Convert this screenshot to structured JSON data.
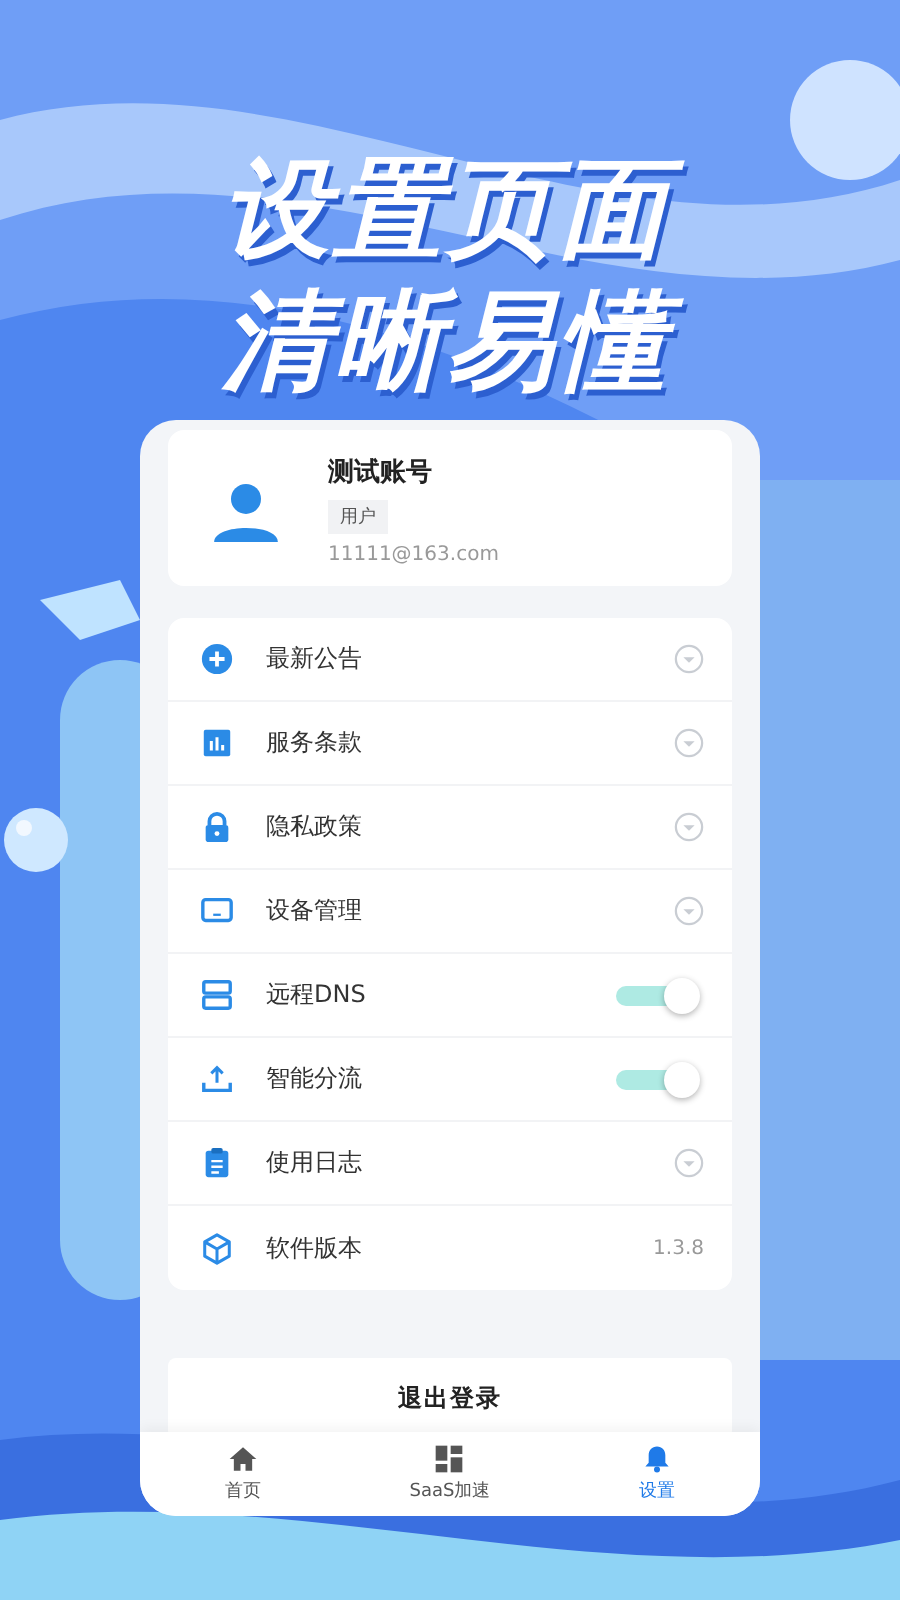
{
  "headline": [
    "设置页面",
    "清晰易懂"
  ],
  "profile": {
    "name": "测试账号",
    "role": "用户",
    "email": "11111@163.com"
  },
  "settings": [
    {
      "kind": "arrow",
      "label": "最新公告"
    },
    {
      "kind": "arrow",
      "label": "服务条款"
    },
    {
      "kind": "arrow",
      "label": "隐私政策"
    },
    {
      "kind": "arrow",
      "label": "设备管理"
    },
    {
      "kind": "toggle",
      "label": "远程DNS",
      "on": true
    },
    {
      "kind": "toggle",
      "label": "智能分流",
      "on": true
    },
    {
      "kind": "arrow",
      "label": "使用日志"
    },
    {
      "kind": "version",
      "label": "软件版本",
      "value": "1.3.8"
    }
  ],
  "logout": "退出登录",
  "tabs": [
    {
      "label": "首页",
      "selected": false
    },
    {
      "label": "SaaS加速",
      "selected": false
    },
    {
      "label": "设置",
      "selected": true
    }
  ]
}
